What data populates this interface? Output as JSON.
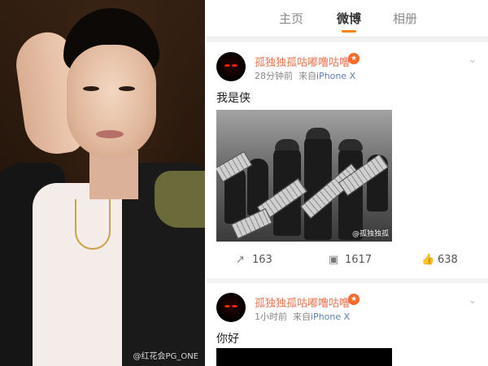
{
  "photo": {
    "watermark": "@红花会PG_ONE"
  },
  "tabs": {
    "home": "主页",
    "weibo": "微博",
    "album": "相册"
  },
  "post1": {
    "username": "孤独独孤咕嘟噜咕噜",
    "time": "28分钟前",
    "source_prefix": "来自",
    "source": "iPhone X",
    "text": "我是侠",
    "image_watermark": "@孤独独孤",
    "actions": {
      "repost": "163",
      "comment": "1617",
      "like": "638"
    }
  },
  "post2": {
    "username": "孤独独孤咕嘟噜咕噜",
    "time": "1小时前",
    "source_prefix": "来自",
    "source": "iPhone X",
    "text": "你好"
  },
  "colors": {
    "accent": "#ff8200",
    "username": "#eb7350",
    "link": "#5d7fae"
  },
  "icons": {
    "repost": "repost-icon",
    "comment": "comment-icon",
    "like": "thumbs-up-icon",
    "menu": "chevron-down-icon"
  }
}
